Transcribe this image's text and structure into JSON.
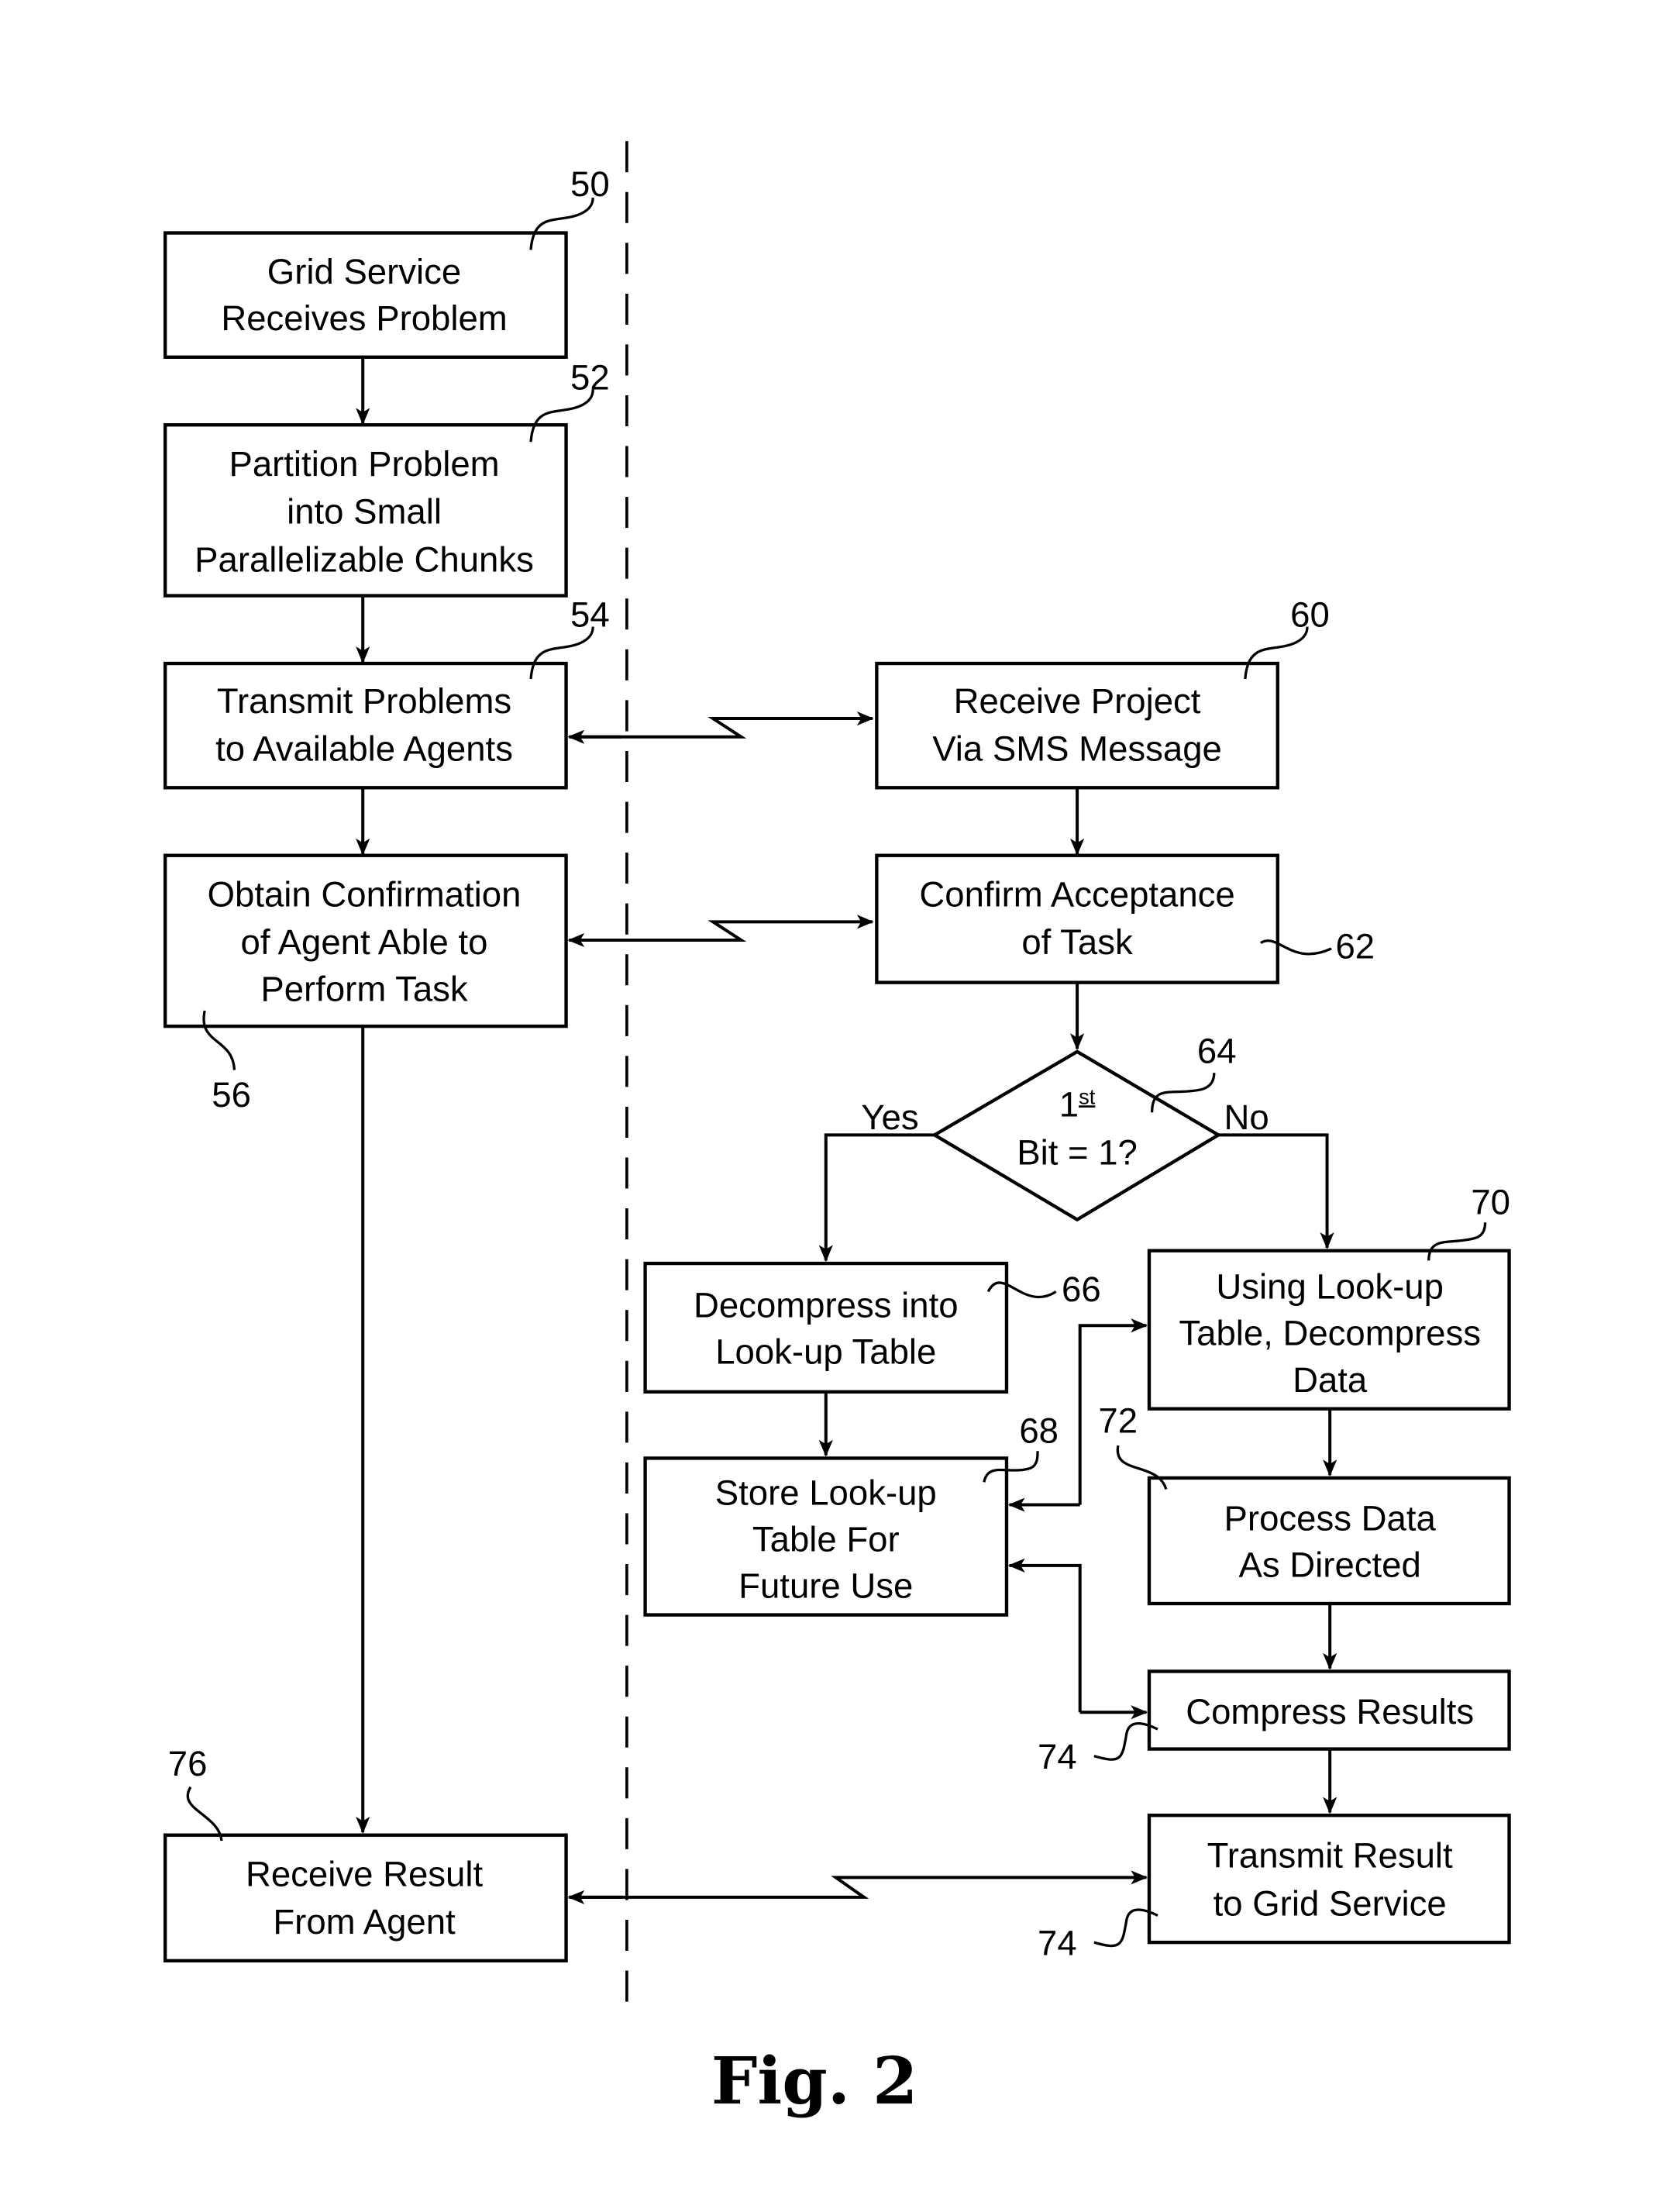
{
  "figure": {
    "caption": "Fig. 2",
    "divider": "dashed-vertical-separator"
  },
  "boxes": {
    "b50": {
      "ref": "50",
      "lines": [
        "Grid Service",
        "Receives Problem"
      ]
    },
    "b52": {
      "ref": "52",
      "lines": [
        "Partition Problem",
        "into Small",
        "Parallelizable Chunks"
      ]
    },
    "b54": {
      "ref": "54",
      "lines": [
        "Transmit Problems",
        "to Available Agents"
      ]
    },
    "b56": {
      "ref": "56",
      "lines": [
        "Obtain Confirmation",
        "of Agent Able to",
        "Perform Task"
      ]
    },
    "b60": {
      "ref": "60",
      "lines": [
        "Receive Project",
        "Via SMS Message"
      ]
    },
    "b62": {
      "ref": "62",
      "lines": [
        "Confirm Acceptance",
        "of Task"
      ]
    },
    "d64": {
      "ref": "64",
      "lines": [
        "1st",
        "Bit = 1?"
      ],
      "yes": "Yes",
      "no": "No"
    },
    "b66": {
      "ref": "66",
      "lines": [
        "Decompress into",
        "Look-up Table"
      ]
    },
    "b68": {
      "ref": "68",
      "lines": [
        "Store Look-up",
        "Table For",
        "Future Use"
      ]
    },
    "b70": {
      "ref": "70",
      "lines": [
        "Using Look-up",
        "Table, Decompress",
        "Data"
      ]
    },
    "b72": {
      "ref": "72",
      "lines": [
        "Process Data",
        "As Directed"
      ]
    },
    "b74a": {
      "ref": "74",
      "lines": [
        "Compress Results"
      ]
    },
    "b74b": {
      "ref": "74",
      "lines": [
        "Transmit Result",
        "to Grid Service"
      ]
    },
    "b76": {
      "ref": "76",
      "lines": [
        "Receive Result",
        "From Agent"
      ]
    }
  }
}
